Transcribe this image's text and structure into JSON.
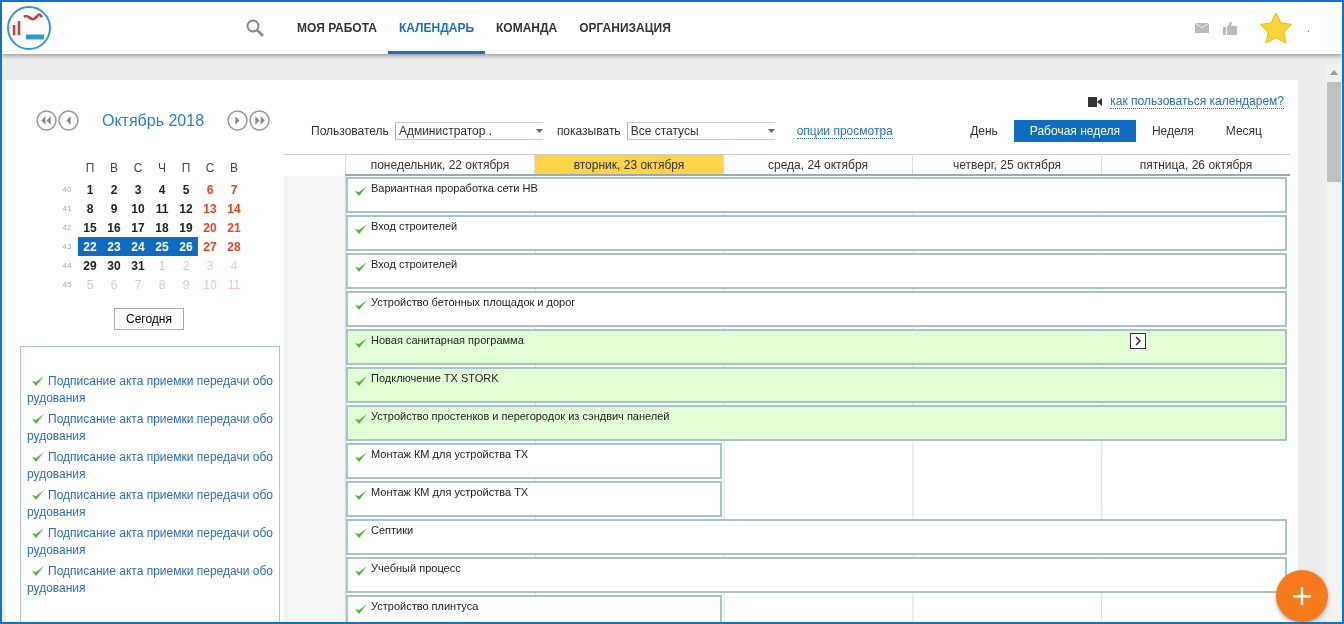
{
  "nav": {
    "items": [
      {
        "label": "МОЯ РАБОТА",
        "selected": false
      },
      {
        "label": "КАЛЕНДАРЬ",
        "selected": true
      },
      {
        "label": "КОМАНДА",
        "selected": false
      },
      {
        "label": "ОРГАНИЗАЦИЯ",
        "selected": false
      }
    ],
    "user_name": "."
  },
  "mini_calendar": {
    "title": "Октябрь 2018",
    "weekdays": [
      "П",
      "В",
      "С",
      "Ч",
      "П",
      "С",
      "В"
    ],
    "weeks": [
      {
        "number": "40",
        "days": [
          {
            "d": "1",
            "weekend": false,
            "other": false,
            "selected": false
          },
          {
            "d": "2",
            "weekend": false,
            "other": false,
            "selected": false
          },
          {
            "d": "3",
            "weekend": false,
            "other": false,
            "selected": false
          },
          {
            "d": "4",
            "weekend": false,
            "other": false,
            "selected": false
          },
          {
            "d": "5",
            "weekend": false,
            "other": false,
            "selected": false
          },
          {
            "d": "6",
            "weekend": true,
            "other": false,
            "selected": false
          },
          {
            "d": "7",
            "weekend": true,
            "other": false,
            "selected": false
          }
        ]
      },
      {
        "number": "41",
        "days": [
          {
            "d": "8",
            "weekend": false,
            "other": false,
            "selected": false
          },
          {
            "d": "9",
            "weekend": false,
            "other": false,
            "selected": false
          },
          {
            "d": "10",
            "weekend": false,
            "other": false,
            "selected": false
          },
          {
            "d": "11",
            "weekend": false,
            "other": false,
            "selected": false
          },
          {
            "d": "12",
            "weekend": false,
            "other": false,
            "selected": false
          },
          {
            "d": "13",
            "weekend": true,
            "other": false,
            "selected": false
          },
          {
            "d": "14",
            "weekend": true,
            "other": false,
            "selected": false
          }
        ]
      },
      {
        "number": "42",
        "days": [
          {
            "d": "15",
            "weekend": false,
            "other": false,
            "selected": false
          },
          {
            "d": "16",
            "weekend": false,
            "other": false,
            "selected": false
          },
          {
            "d": "17",
            "weekend": false,
            "other": false,
            "selected": false
          },
          {
            "d": "18",
            "weekend": false,
            "other": false,
            "selected": false
          },
          {
            "d": "19",
            "weekend": false,
            "other": false,
            "selected": false
          },
          {
            "d": "20",
            "weekend": true,
            "other": false,
            "selected": false
          },
          {
            "d": "21",
            "weekend": true,
            "other": false,
            "selected": false
          }
        ]
      },
      {
        "number": "43",
        "days": [
          {
            "d": "22",
            "weekend": false,
            "other": false,
            "selected": true
          },
          {
            "d": "23",
            "weekend": false,
            "other": false,
            "selected": true
          },
          {
            "d": "24",
            "weekend": false,
            "other": false,
            "selected": true
          },
          {
            "d": "25",
            "weekend": false,
            "other": false,
            "selected": true
          },
          {
            "d": "26",
            "weekend": false,
            "other": false,
            "selected": true
          },
          {
            "d": "27",
            "weekend": true,
            "other": false,
            "selected": false
          },
          {
            "d": "28",
            "weekend": true,
            "other": false,
            "selected": false
          }
        ]
      },
      {
        "number": "44",
        "days": [
          {
            "d": "29",
            "weekend": false,
            "other": false,
            "selected": false
          },
          {
            "d": "30",
            "weekend": false,
            "other": false,
            "selected": false
          },
          {
            "d": "31",
            "weekend": false,
            "other": false,
            "selected": false
          },
          {
            "d": "1",
            "weekend": false,
            "other": true,
            "selected": false
          },
          {
            "d": "2",
            "weekend": false,
            "other": true,
            "selected": false
          },
          {
            "d": "3",
            "weekend": true,
            "other": true,
            "selected": false
          },
          {
            "d": "4",
            "weekend": true,
            "other": true,
            "selected": false
          }
        ]
      },
      {
        "number": "45",
        "days": [
          {
            "d": "5",
            "weekend": false,
            "other": true,
            "selected": false
          },
          {
            "d": "6",
            "weekend": false,
            "other": true,
            "selected": false
          },
          {
            "d": "7",
            "weekend": false,
            "other": true,
            "selected": false
          },
          {
            "d": "8",
            "weekend": false,
            "other": true,
            "selected": false
          },
          {
            "d": "9",
            "weekend": false,
            "other": true,
            "selected": false
          },
          {
            "d": "10",
            "weekend": true,
            "other": true,
            "selected": false
          },
          {
            "d": "11",
            "weekend": true,
            "other": true,
            "selected": false
          }
        ]
      }
    ],
    "today_button": "Сегодня"
  },
  "task_list": [
    {
      "title": "Подписание акта приемки передачи оборудования",
      "done": true
    },
    {
      "title": "Подписание акта приемки передачи оборудования",
      "done": true
    },
    {
      "title": "Подписание акта приемки передачи оборудования",
      "done": true
    },
    {
      "title": "Подписание акта приемки передачи оборудования",
      "done": true
    },
    {
      "title": "Подписание акта приемки передачи оборудования",
      "done": true
    },
    {
      "title": "Подписание акта приемки передачи оборудования",
      "done": true
    }
  ],
  "help_link": "как пользоваться календарем?",
  "filters": {
    "user_label": "Пользователь",
    "user_value": "Администратор .",
    "show_label": "показывать",
    "show_value": "Все статусы",
    "options_link": "опции просмотра"
  },
  "views": [
    {
      "label": "День",
      "selected": false
    },
    {
      "label": "Рабочая неделя",
      "selected": true
    },
    {
      "label": "Неделя",
      "selected": false
    },
    {
      "label": "Месяц",
      "selected": false
    }
  ],
  "days": [
    {
      "label": "понедельник, 22 октября",
      "selected": false
    },
    {
      "label": "вторник, 23 октября",
      "selected": true
    },
    {
      "label": "среда, 24 октября",
      "selected": false
    },
    {
      "label": "четверг, 25 октября",
      "selected": false
    },
    {
      "label": "пятница, 26 октября",
      "selected": false
    }
  ],
  "events": [
    {
      "title": "Вариантная проработка сети НВ",
      "kind": "week",
      "highlight": false,
      "done": true,
      "continues": false
    },
    {
      "title": "Вход строителей",
      "kind": "week",
      "highlight": false,
      "done": true,
      "continues": false
    },
    {
      "title": "Вход строителей",
      "kind": "week",
      "highlight": false,
      "done": true,
      "continues": false
    },
    {
      "title": "Устройство бетонных площадок и дорог",
      "kind": "week",
      "highlight": false,
      "done": true,
      "continues": false
    },
    {
      "title": "Новая санитарная программа",
      "kind": "week",
      "highlight": true,
      "done": true,
      "continues": true
    },
    {
      "title": "Подключение ТХ STORK",
      "kind": "week",
      "highlight": true,
      "done": true,
      "continues": false
    },
    {
      "title": "Устройство простенков и перегородок из сэндвич панелей",
      "kind": "week",
      "highlight": true,
      "done": true,
      "continues": false
    },
    {
      "title": "Монтаж КМ для устройства ТХ",
      "kind": "short",
      "highlight": false,
      "done": true,
      "continues": false
    },
    {
      "title": "Монтаж КМ для устройства ТХ",
      "kind": "short",
      "highlight": false,
      "done": true,
      "continues": false
    },
    {
      "title": "Септики",
      "kind": "week",
      "highlight": false,
      "done": true,
      "continues": false
    },
    {
      "title": "Учебный процесс",
      "kind": "week",
      "highlight": false,
      "done": true,
      "continues": false
    },
    {
      "title": "Устройство плинтуса",
      "kind": "short",
      "highlight": false,
      "done": true,
      "continues": false
    }
  ],
  "add_button": "+"
}
